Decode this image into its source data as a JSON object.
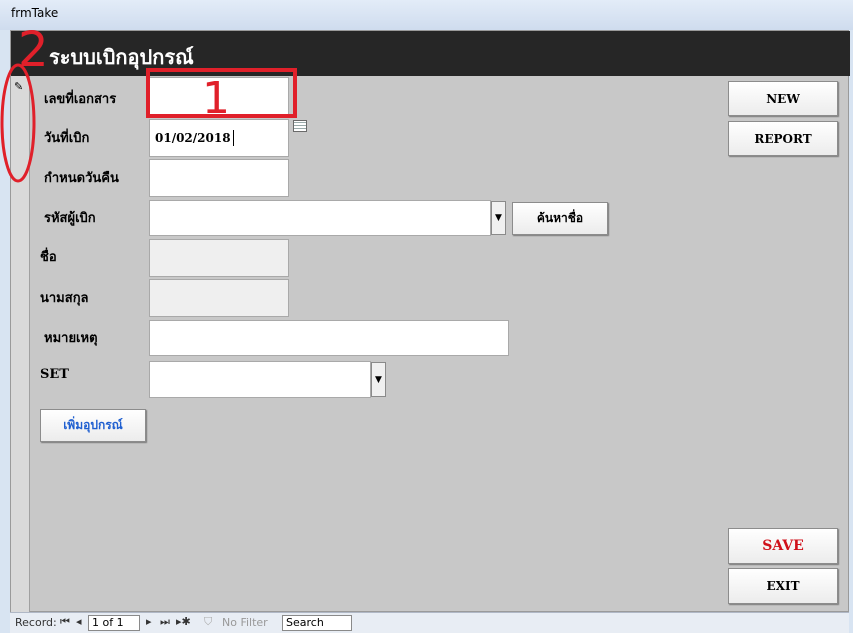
{
  "window": {
    "title": "frmTake"
  },
  "header": {
    "title": "ระบบเบิกอุปกรณ์"
  },
  "fields": {
    "doc_no": {
      "label": "เลขที่เอกสาร",
      "value": ""
    },
    "take_date": {
      "label": "วันที่เบิก",
      "value": "01/02/2018"
    },
    "return_date": {
      "label": "กำหนดวันคืน",
      "value": ""
    },
    "borrower_id": {
      "label": "รหัสผู้เบิก",
      "value": ""
    },
    "first_name": {
      "label": "ชื่อ",
      "value": ""
    },
    "last_name": {
      "label": "นามสกุล",
      "value": ""
    },
    "remark": {
      "label": "หมายเหตุ",
      "value": ""
    },
    "set": {
      "label": "SET",
      "value": ""
    }
  },
  "buttons": {
    "search_name": "ค้นหาชื่อ",
    "add_equipment": "เพิ่มอุปกรณ์",
    "new": "NEW",
    "report": "REPORT",
    "save": "SAVE",
    "exit": "EXIT"
  },
  "colors": {
    "save_text": "#d0101a",
    "add_equipment_text": "#1f5fd0",
    "annotation": "#e0202a"
  },
  "annotations": {
    "box_number": "1",
    "side_number": "2"
  },
  "record_nav": {
    "label": "Record:",
    "position": "1 of 1",
    "filter": "No Filter",
    "search_placeholder": "Search"
  }
}
